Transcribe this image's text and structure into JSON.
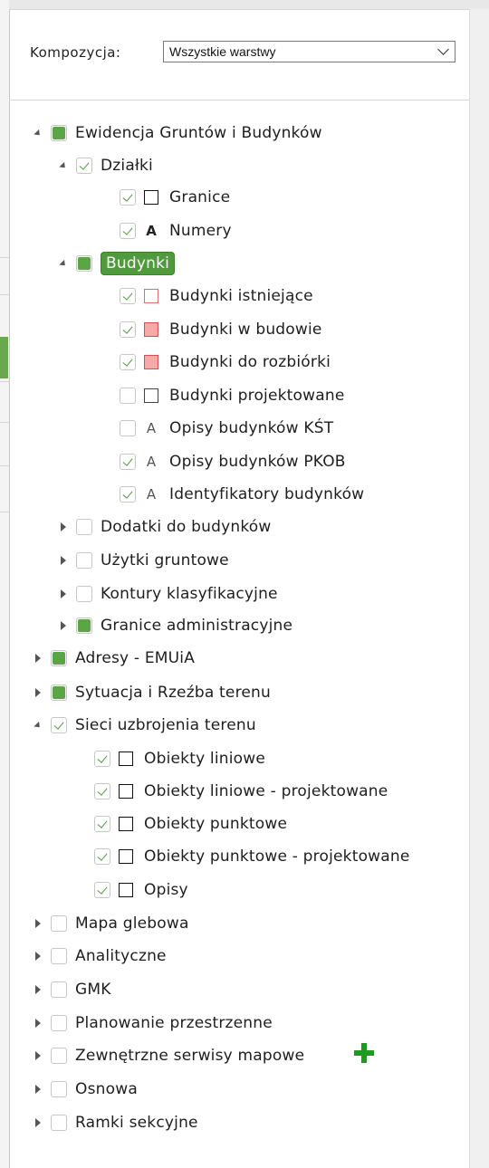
{
  "composition": {
    "label": "Kompozycja:",
    "selected": "Wszystkie warstwy"
  },
  "tree": [
    {
      "label": "Ewidencja Gruntów i Budynków",
      "state": "partial",
      "expander": "open",
      "symbol": null,
      "name": "ewidencja"
    },
    {
      "label": "Działki",
      "state": "checked",
      "expander": "open",
      "symbol": null,
      "name": "dzialki"
    },
    {
      "label": "Granice",
      "state": "checked",
      "expander": "none",
      "symbol": "sq-black",
      "name": "granice"
    },
    {
      "label": "Numery",
      "state": "checked",
      "expander": "none",
      "symbol": "letter-A",
      "name": "numery"
    },
    {
      "label": "Budynki",
      "state": "partial",
      "expander": "open",
      "symbol": null,
      "selected": true,
      "name": "budynki"
    },
    {
      "label": "Budynki istniejące",
      "state": "checked",
      "expander": "none",
      "symbol": "sq-pinkline",
      "name": "budynki-istniejace"
    },
    {
      "label": "Budynki w budowie",
      "state": "checked",
      "expander": "none",
      "symbol": "sq-pinkfill",
      "name": "budynki-w-budowie"
    },
    {
      "label": "Budynki do rozbiórki",
      "state": "checked",
      "expander": "none",
      "symbol": "sq-pinkfill",
      "name": "budynki-do-rozbiorki"
    },
    {
      "label": "Budynki projektowane",
      "state": "unchecked",
      "expander": "none",
      "symbol": "sq-gray",
      "name": "budynki-projektowane"
    },
    {
      "label": "Opisy budynków KŚT",
      "state": "unchecked",
      "expander": "none",
      "symbol": "letter-A-light",
      "name": "opisy-kst"
    },
    {
      "label": "Opisy budynków PKOB",
      "state": "checked",
      "expander": "none",
      "symbol": "letter-A-light",
      "name": "opisy-pkob"
    },
    {
      "label": "Identyfikatory budynków",
      "state": "checked",
      "expander": "none",
      "symbol": "letter-A-light",
      "name": "identyfikatory"
    },
    {
      "label": "Dodatki do budynków",
      "state": "unchecked",
      "expander": "closed",
      "symbol": null,
      "name": "dodatki"
    },
    {
      "label": "Użytki gruntowe",
      "state": "unchecked",
      "expander": "closed",
      "symbol": null,
      "name": "uzytki"
    },
    {
      "label": "Kontury klasyfikacyjne",
      "state": "unchecked",
      "expander": "closed",
      "symbol": null,
      "name": "kontury"
    },
    {
      "label": "Granice administracyjne",
      "state": "partial",
      "expander": "closed",
      "symbol": null,
      "name": "granice-administracyjne"
    },
    {
      "label": "Adresy - EMUiA",
      "state": "partial",
      "expander": "closed",
      "symbol": null,
      "name": "adresy"
    },
    {
      "label": "Sytuacja i Rzeźba terenu",
      "state": "partial",
      "expander": "closed",
      "symbol": null,
      "name": "sytuacja"
    },
    {
      "label": "Sieci uzbrojenia terenu",
      "state": "checked",
      "expander": "open",
      "symbol": null,
      "name": "sieci"
    },
    {
      "label": "Obiekty liniowe",
      "state": "checked",
      "expander": "none",
      "symbol": "sq-black",
      "name": "obiekty-liniowe"
    },
    {
      "label": "Obiekty liniowe - projektowane",
      "state": "checked",
      "expander": "none",
      "symbol": "sq-black",
      "name": "obiekty-liniowe-projektowane"
    },
    {
      "label": "Obiekty punktowe",
      "state": "checked",
      "expander": "none",
      "symbol": "sq-black",
      "name": "obiekty-punktowe"
    },
    {
      "label": "Obiekty punktowe - projektowane",
      "state": "checked",
      "expander": "none",
      "symbol": "sq-black",
      "name": "obiekty-punktowe-projektowane"
    },
    {
      "label": "Opisy",
      "state": "checked",
      "expander": "none",
      "symbol": "sq-black",
      "name": "opisy"
    },
    {
      "label": "Mapa glebowa",
      "state": "unchecked",
      "expander": "closed",
      "symbol": null,
      "name": "mapa-glebowa"
    },
    {
      "label": "Analityczne",
      "state": "unchecked",
      "expander": "closed",
      "symbol": null,
      "name": "analityczne"
    },
    {
      "label": "GMK",
      "state": "unchecked",
      "expander": "closed",
      "symbol": null,
      "name": "gmk"
    },
    {
      "label": "Planowanie przestrzenne",
      "state": "unchecked",
      "expander": "closed",
      "symbol": null,
      "name": "planowanie"
    },
    {
      "label": "Zewnętrzne serwisy mapowe",
      "state": "unchecked",
      "expander": "closed",
      "symbol": null,
      "name": "zewnetrzne-serwisy"
    },
    {
      "label": "Osnowa",
      "state": "unchecked",
      "expander": "closed",
      "symbol": null,
      "name": "osnowa"
    },
    {
      "label": "Ramki sekcyjne",
      "state": "unchecked",
      "expander": "closed",
      "symbol": null,
      "name": "ramki-sekcyjne"
    }
  ],
  "icons": {
    "add": "plus-icon",
    "add_color": "#1f9a1f",
    "accent": "#4f9a3c"
  }
}
